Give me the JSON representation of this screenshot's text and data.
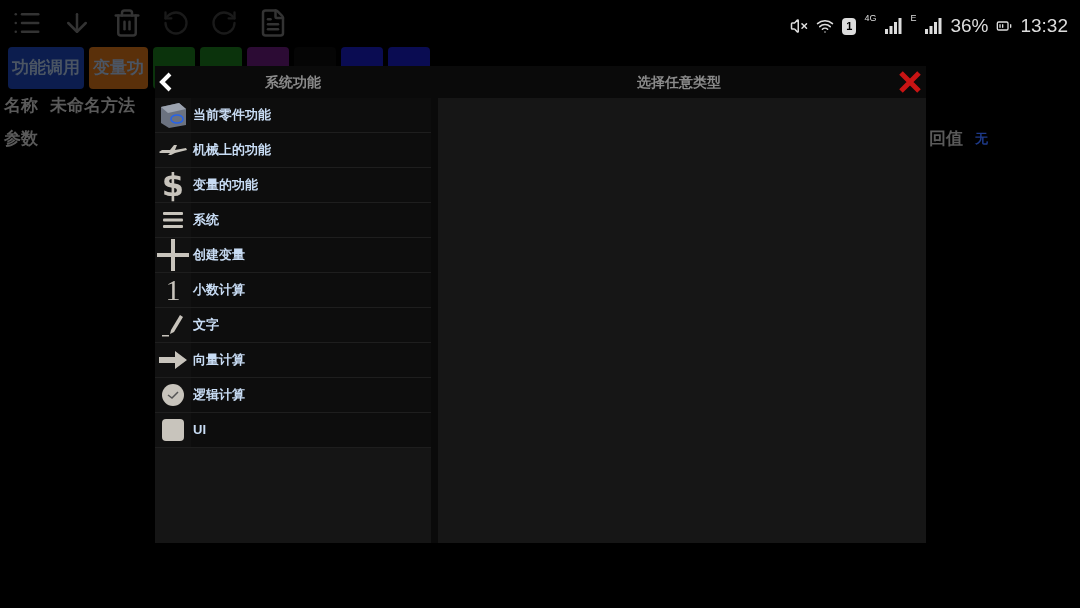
{
  "status_bar": {
    "network_4g": "4G",
    "sim_slot": "1",
    "network_e": "E",
    "battery": "36%",
    "time": "13:32"
  },
  "tabs": [
    {
      "label": "功能调用",
      "color": "#0c1d4e"
    },
    {
      "label": "变量功",
      "color": "#5a300a"
    },
    {
      "color": "#0b330c"
    },
    {
      "color": "#0b330c"
    },
    {
      "color": "#2c0b34"
    },
    {
      "color": "#050505"
    },
    {
      "color": "#0a0c52"
    },
    {
      "color": "#0a0c52"
    }
  ],
  "method": {
    "name_label": "名称",
    "name_value": "未命名方法",
    "params_label": "参数",
    "return_label": "回值",
    "return_value": "无"
  },
  "dialog": {
    "left_title": "系统功能",
    "right_title": "选择任意类型",
    "items": [
      {
        "kind": "part",
        "label": "当前零件功能"
      },
      {
        "kind": "plane",
        "label": "机械上的功能"
      },
      {
        "kind": "dollar",
        "glyph": "$",
        "label": "变量的功能"
      },
      {
        "kind": "lines",
        "label": "系统"
      },
      {
        "kind": "plus",
        "label": "创建变量"
      },
      {
        "kind": "one",
        "glyph": "1",
        "label": "小数计算"
      },
      {
        "kind": "pencil",
        "label": "文字"
      },
      {
        "kind": "arrow",
        "label": "向量计算"
      },
      {
        "kind": "check",
        "label": "逻辑计算"
      },
      {
        "kind": "square",
        "label": "UI"
      }
    ]
  }
}
